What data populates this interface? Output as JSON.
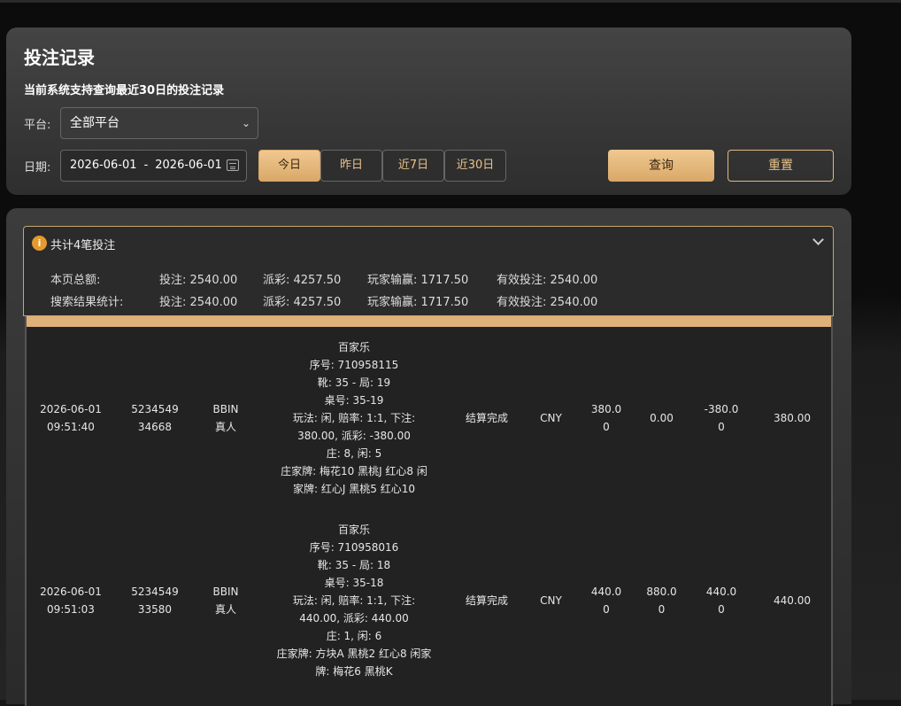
{
  "header": {
    "title": "投注记录",
    "subtitle": "当前系统支持查询最近30日的投注记录",
    "platform_label": "平台:",
    "platform_value": "全部平台",
    "date_label": "日期:",
    "date_start": "2026-06-01",
    "date_sep": "-",
    "date_end": "2026-06-01",
    "ranges": [
      "今日",
      "昨日",
      "近7日",
      "近30日"
    ],
    "active_range": "今日",
    "query_label": "查询",
    "reset_label": "重置"
  },
  "summary": {
    "title": "共计4笔投注",
    "rows": [
      {
        "label": "本页总额:",
        "bet": "投注: 2540.00",
        "payout": "派彩: 4257.50",
        "winloss": "玩家输赢: 1717.50",
        "valid": "有效投注: 2540.00"
      },
      {
        "label": "搜索结果统计:",
        "bet": "投注: 2540.00",
        "payout": "派彩: 4257.50",
        "winloss": "玩家输赢: 1717.50",
        "valid": "有效投注: 2540.00"
      }
    ]
  },
  "records": [
    {
      "time": [
        "2026-06-01",
        "09:51:40"
      ],
      "order": [
        "5234549",
        "34668"
      ],
      "platform": [
        "BBIN",
        "真人"
      ],
      "detail": [
        "百家乐",
        "序号: 710958115",
        "靴: 35 - 局: 19",
        "桌号: 35-19",
        "玩法: 闲, 赔率: 1:1, 下注:",
        "380.00, 派彩: -380.00",
        "庄: 8, 闲: 5",
        "庄家牌: 梅花10 黑桃J 红心8 闲",
        "家牌: 红心J 黑桃5 红心10"
      ],
      "status": "结算完成",
      "currency": "CNY",
      "bet": [
        "380.0",
        "0"
      ],
      "payout": [
        "0.00"
      ],
      "winloss": [
        "-380.0",
        "0"
      ],
      "valid": "380.00"
    },
    {
      "time": [
        "2026-06-01",
        "09:51:03"
      ],
      "order": [
        "5234549",
        "33580"
      ],
      "platform": [
        "BBIN",
        "真人"
      ],
      "detail": [
        "百家乐",
        "序号: 710958016",
        "靴: 35 - 局: 18",
        "桌号: 35-18",
        "玩法: 闲, 赔率: 1:1, 下注:",
        "440.00, 派彩: 440.00",
        "庄: 1, 闲: 6",
        "庄家牌: 方块A 黑桃2 红心8 闲家",
        "牌: 梅花6 黑桃K"
      ],
      "status": "结算完成",
      "currency": "CNY",
      "bet": [
        "440.0",
        "0"
      ],
      "payout": [
        "880.0",
        "0"
      ],
      "winloss": [
        "440.0",
        "0"
      ],
      "valid": "440.00"
    }
  ]
}
